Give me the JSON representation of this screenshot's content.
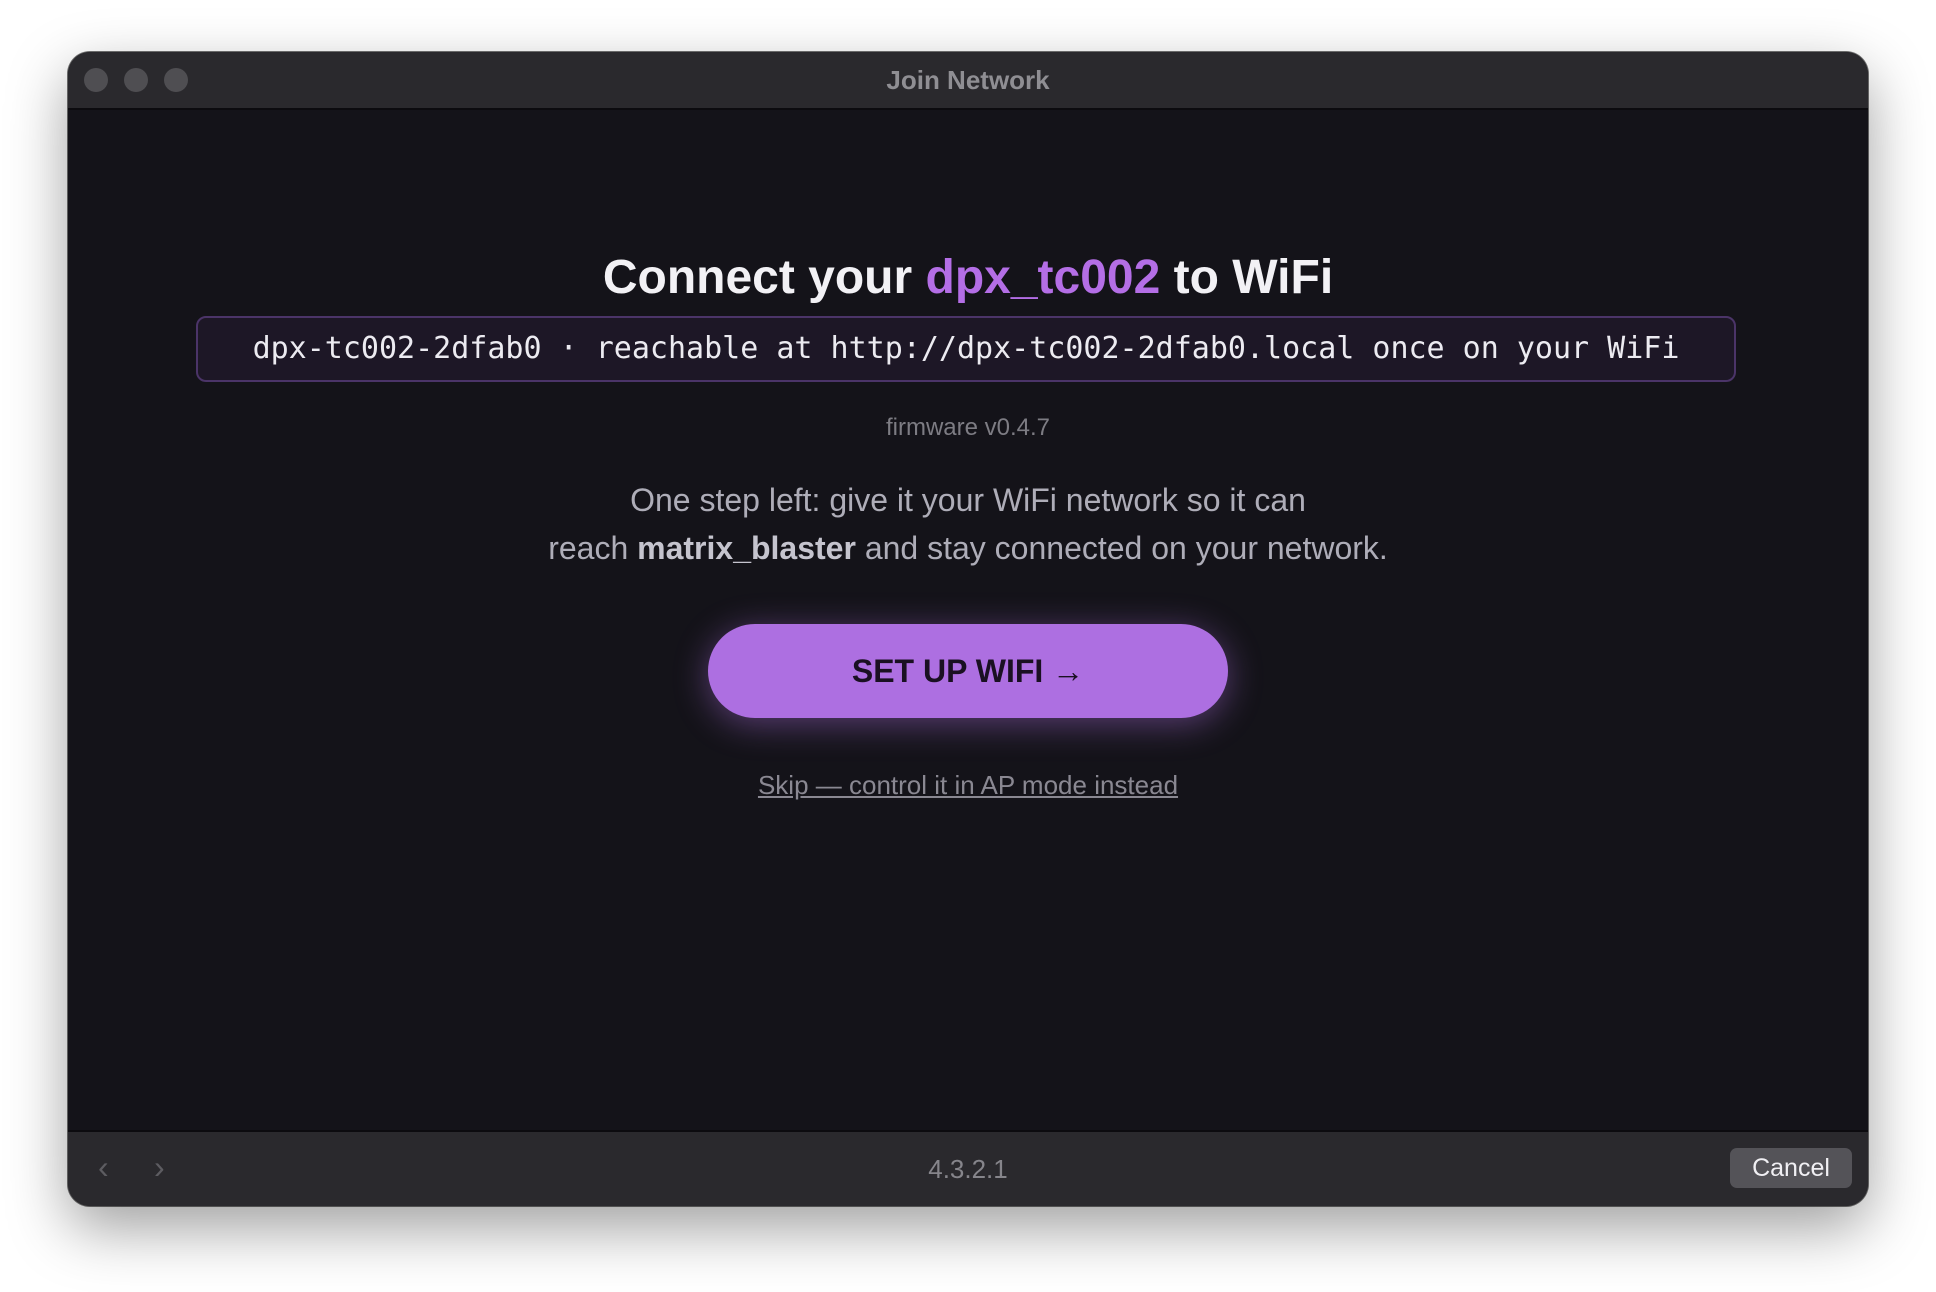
{
  "window": {
    "title": "Join Network"
  },
  "main": {
    "heading_prefix": "Connect your ",
    "heading_device": "dpx_tc002",
    "heading_suffix": " to WiFi",
    "host_info": "dpx-tc002-2dfab0 · reachable at http://dpx-tc002-2dfab0.local once on your WiFi",
    "firmware": "firmware v0.4.7",
    "desc_line1": "One step left: give it your WiFi network so it can",
    "desc_line2_prefix": "reach ",
    "desc_line2_bold": "matrix_blaster",
    "desc_line2_suffix": " and stay connected on your network.",
    "cta_label": "SET UP WIFI →",
    "skip_link": "Skip — control it in AP mode instead"
  },
  "footer": {
    "back_icon": "‹",
    "forward_icon": "›",
    "address": "4.3.2.1",
    "cancel_label": "Cancel"
  },
  "colors": {
    "accent": "#b46ee6",
    "button": "#ad6fe1",
    "background": "#141319"
  }
}
